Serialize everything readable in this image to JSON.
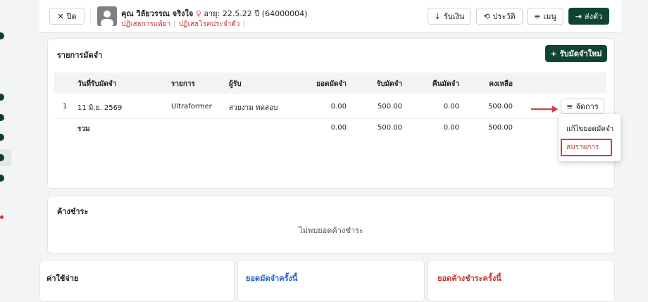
{
  "header": {
    "close_label": "ปิด",
    "patient_name": "คุณ วิลัยวรรณ จริงใจ",
    "age_text": "อายุ: 22.5.22 ปี (64000004)",
    "allergy_drug": "ปฏิเสธการแพ้ยา",
    "allergy_disease": "ปฏิเสธโรคประจำตัว",
    "buttons": {
      "receive": "รับเงิน",
      "history": "ประวัติ",
      "menu": "เมนู",
      "send": "ส่งตัว"
    }
  },
  "deposit": {
    "title": "รายการมัดจำ",
    "new_button": "รับมัดจำใหม่",
    "columns": [
      "วันที่รับมัดจำ",
      "รายการ",
      "ผู้รับ",
      "ยอดมัดจำ",
      "รับมัดจำ",
      "คืนมัดจำ",
      "คงเหลือ"
    ],
    "rows": [
      {
        "no": "1",
        "date": "11 มิ.ย. 2569",
        "item": "Ultraformer",
        "receiver": "สวยงาม ทดสอบ",
        "amount": "0.00",
        "received": "500.00",
        "refunded": "0.00",
        "balance": "500.00",
        "action": "จัดการ"
      }
    ],
    "total": {
      "label": "รวม",
      "amount": "0.00",
      "received": "500.00",
      "refunded": "0.00",
      "balance": "500.00"
    },
    "menu_items": [
      "แก้ไขยอดมัดจำ",
      "ลบรายการ"
    ]
  },
  "outstanding": {
    "title": "ค้างชำระ",
    "empty_text": "ไม่พบยอดค้างชำระ"
  },
  "bottom": {
    "expenses_title": "ค่าใช้จ่าย",
    "deposit_this_title": "ยอดมัดจำครั้งนี้",
    "outstanding_this_title": "ยอดค้างชำระครั้งนี้"
  },
  "colors": {
    "brand": "#0f4433",
    "danger": "#d9363e",
    "link": "#2563c9"
  }
}
